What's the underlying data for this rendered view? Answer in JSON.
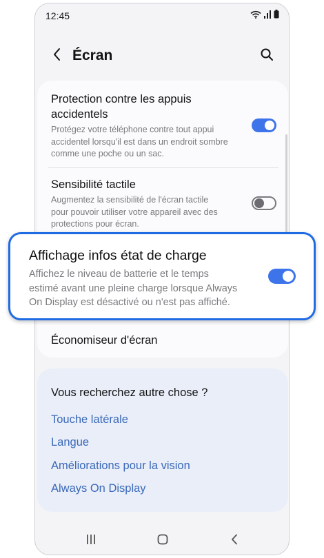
{
  "status_bar": {
    "time": "12:45",
    "icons": [
      "wifi-icon",
      "signal-icon",
      "battery-icon"
    ]
  },
  "header": {
    "title": "Écran",
    "back_icon": "chevron-left-icon",
    "search_icon": "search-icon"
  },
  "settings": [
    {
      "title_line1": "Protection contre les appuis",
      "title_line2": "accidentels",
      "desc_line1": "Protégez votre téléphone contre tout appui",
      "desc_line2": "accidentel lorsqu'il est dans un endroit sombre",
      "desc_line3": "comme une poche ou un sac.",
      "enabled": true
    },
    {
      "title": "Sensibilité tactile",
      "desc_line1": "Augmentez la sensibilité de l'écran tactile",
      "desc_line2": "pour pouvoir utiliser votre appareil avec des",
      "desc_line3": "protections pour écran.",
      "enabled": false
    },
    {
      "title": "Économiseur d'écran"
    }
  ],
  "highlight": {
    "title": "Affichage infos état de charge",
    "desc_line1": "Affichez le niveau de batterie et le temps",
    "desc_line2": "estimé avant une pleine charge lorsque Always",
    "desc_line3": "On Display est désactivé ou n'est pas affiché.",
    "enabled": true
  },
  "suggestions": {
    "title": "Vous recherchez autre chose ?",
    "links": [
      "Touche latérale",
      "Langue",
      "Améliorations pour la vision",
      "Always On Display"
    ]
  },
  "navbar": {
    "recents_icon": "recents-icon",
    "home_icon": "home-icon",
    "back_icon": "back-icon"
  },
  "colors": {
    "accent": "#3e74ea",
    "highlight_border": "#1f6be3",
    "link": "#3a69b8",
    "suggest_bg": "#e9eef9"
  }
}
